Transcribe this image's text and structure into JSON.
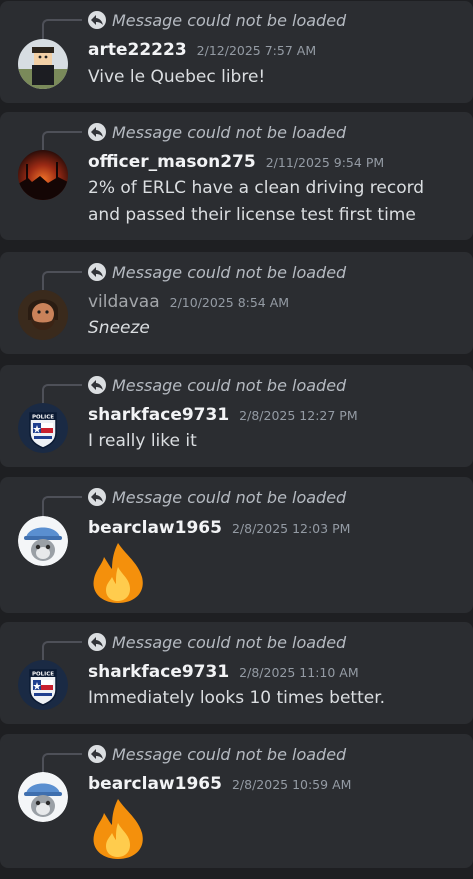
{
  "reply_placeholder": "Message could not be loaded",
  "messages": [
    {
      "username": "arte22223",
      "timestamp": "2/12/2025 7:57 AM",
      "text": "Vive le Quebec libre!",
      "avatar": "roblox-avatar-icon"
    },
    {
      "username": "officer_mason275",
      "timestamp": "2/11/2025 9:54 PM",
      "text": "2% of ERLC have a clean driving record and passed their license test first time",
      "avatar": "sunset-avatar-icon"
    },
    {
      "username": "vildavaa",
      "timestamp": "2/10/2025 8:54 AM",
      "text": "Sneeze",
      "avatar": "bearded-man-avatar-icon"
    },
    {
      "username": "sharkface9731",
      "timestamp": "2/8/2025 12:27 PM",
      "text": "I really like it",
      "avatar": "police-badge-avatar-icon"
    },
    {
      "username": "bearclaw1965",
      "timestamp": "2/8/2025 12:03 PM",
      "text": "",
      "emoji": "fire-emoji-icon",
      "avatar": "cat-avatar-icon"
    },
    {
      "username": "sharkface9731",
      "timestamp": "2/8/2025 11:10 AM",
      "text": "Immediately looks 10 times better.",
      "avatar": "police-badge-avatar-icon"
    },
    {
      "username": "bearclaw1965",
      "timestamp": "2/8/2025 10:59 AM",
      "text": "",
      "emoji": "fire-emoji-icon",
      "avatar": "cat-avatar-icon"
    }
  ]
}
